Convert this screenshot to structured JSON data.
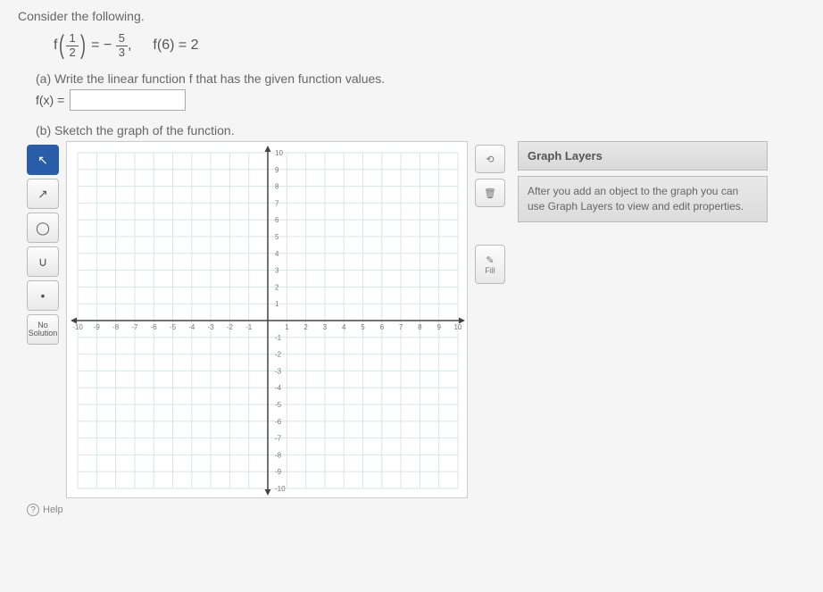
{
  "intro": "Consider the following.",
  "eq1": {
    "f_label": "f",
    "arg_num": "1",
    "arg_den": "2",
    "equals": " = ",
    "neg": "−",
    "val_num": "5",
    "val_den": "3",
    "comma": ","
  },
  "eq2": "f(6) = 2",
  "partA": {
    "label": "(a) Write the linear function f that has the given function values.",
    "fx": "f(x) =",
    "value": ""
  },
  "partB": {
    "label": "(b) Sketch the graph of the function."
  },
  "tools": {
    "pointer": "↖",
    "line": "↗",
    "circle": "◯",
    "parabola": "∪",
    "point": "•",
    "nosol_line1": "No",
    "nosol_line2": "Solution"
  },
  "side": {
    "undo": "⟲",
    "delete": "🗑",
    "fill": "Fill",
    "fill_icon": "✎"
  },
  "layers": {
    "title": "Graph Layers",
    "desc": "After you add an object to the graph you can use Graph Layers to view and edit properties."
  },
  "chart_data": {
    "type": "scatter",
    "title": "",
    "xlabel": "",
    "ylabel": "",
    "xlim": [
      -10,
      10
    ],
    "ylim": [
      -10,
      10
    ],
    "x_ticks": [
      -10,
      -9,
      -8,
      -7,
      -6,
      -5,
      -4,
      -3,
      -2,
      -1,
      1,
      2,
      3,
      4,
      5,
      6,
      7,
      8,
      9,
      10
    ],
    "y_ticks": [
      -10,
      -9,
      -8,
      -7,
      -6,
      -5,
      -4,
      -3,
      -2,
      -1,
      1,
      2,
      3,
      4,
      5,
      6,
      7,
      8,
      9,
      10
    ],
    "grid": true,
    "series": []
  },
  "footer": {
    "help": "Help"
  }
}
